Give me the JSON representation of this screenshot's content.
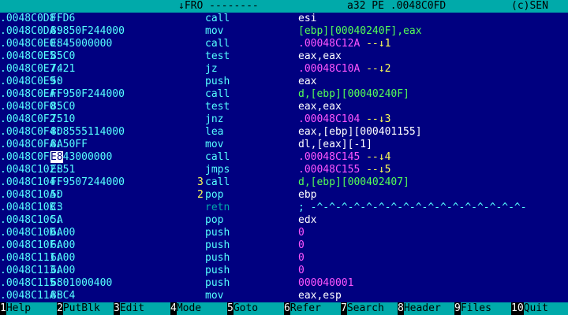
{
  "statusbar": {
    "left": "↓FRO --------",
    "middle": "a32 PE .0048C0FD",
    "right": "(c)SEN"
  },
  "rows": [
    {
      "addr": ".0048C0D8:",
      "hex": "FFD6",
      "mnem": "call",
      "op": "esi",
      "op_color": "white"
    },
    {
      "addr": ".0048C0DA:",
      "hex": "89850F244000",
      "mnem": "mov",
      "op": "[ebp][00040240F],eax",
      "op_color": "green"
    },
    {
      "addr": ".0048C0E0:",
      "hex": "E845000000",
      "mnem": "call",
      "op": ".00048C12A",
      "op_color": "magenta",
      "arrow": " --↓1"
    },
    {
      "addr": ".0048C0E5:",
      "hex": "85C0",
      "mnem": "test",
      "op": "eax,eax",
      "op_color": "white"
    },
    {
      "addr": ".0048C0E7:",
      "hex": "7421",
      "mnem": "jz",
      "op": ".00048C10A",
      "op_color": "magenta",
      "arrow": " --↓2"
    },
    {
      "addr": ".0048C0E9:",
      "hex": "50",
      "mnem": "push",
      "op": "eax",
      "op_color": "white"
    },
    {
      "addr": ".0048C0EA:",
      "hex": "FF950F244000",
      "mnem": "call",
      "op": "d,[ebp][00040240F]",
      "op_color": "green"
    },
    {
      "addr": ".0048C0F0:",
      "hex": "85C0",
      "mnem": "test",
      "op": "eax,eax",
      "op_color": "white"
    },
    {
      "addr": ".0048C0F2:",
      "hex": "7510",
      "mnem": "jnz",
      "op": ".00048C104",
      "op_color": "magenta",
      "arrow": " --↓3"
    },
    {
      "addr": ".0048C0F4:",
      "hex": "8D8555114000",
      "mnem": "lea",
      "op": "eax,[ebp][000401155]",
      "op_color": "white"
    },
    {
      "addr": ".0048C0FA:",
      "hex": "8A50FF",
      "mnem": "mov",
      "op": "dl,[eax][-1]",
      "op_color": "white"
    },
    {
      "addr": ".0048C0FD:",
      "hex_cursor": "E8",
      "hex": "43000000",
      "mnem": "call",
      "op": ".00048C145",
      "op_color": "magenta",
      "arrow": " --↓4"
    },
    {
      "addr": ".0048C102:",
      "hex": "EB51",
      "mnem": "jmps",
      "op": ".00048C155",
      "op_color": "magenta",
      "arrow": " --↓5"
    },
    {
      "addr": ".0048C104:",
      "hex": "FF9507244000",
      "marker": "3",
      "mnem": "call",
      "op": "d,[ebp][000402407]",
      "op_color": "green"
    },
    {
      "addr": ".0048C10A:",
      "hex": "5D",
      "marker": "2",
      "mnem": "pop",
      "op": "ebp",
      "op_color": "white"
    },
    {
      "addr": ".0048C10B:",
      "hex": "C3",
      "mnem": "retn",
      "op": "; -^-^-^-^-^-^-^-^-^-^-^-^-^-^-^-^-^-",
      "op_color": "retn"
    },
    {
      "addr": ".0048C10C:",
      "hex": "5A",
      "mnem": "pop",
      "op": "edx",
      "op_color": "white"
    },
    {
      "addr": ".0048C10D:",
      "hex": "6A00",
      "mnem": "push",
      "op": "0",
      "op_color": "magenta"
    },
    {
      "addr": ".0048C10F:",
      "hex": "6A00",
      "mnem": "push",
      "op": "0",
      "op_color": "magenta"
    },
    {
      "addr": ".0048C111:",
      "hex": "6A00",
      "mnem": "push",
      "op": "0",
      "op_color": "magenta"
    },
    {
      "addr": ".0048C113:",
      "hex": "6A00",
      "mnem": "push",
      "op": "0",
      "op_color": "magenta"
    },
    {
      "addr": ".0048C115:",
      "hex": "6801000400",
      "mnem": "push",
      "op": "000040001",
      "op_color": "magenta"
    },
    {
      "addr": ".0048C11A:",
      "hex": "8BC4",
      "mnem": "mov",
      "op": "eax,esp",
      "op_color": "white"
    }
  ],
  "fkeys": [
    {
      "num": "1",
      "label": "Help"
    },
    {
      "num": "2",
      "label": "PutBlk"
    },
    {
      "num": "3",
      "label": "Edit"
    },
    {
      "num": "4",
      "label": "Mode"
    },
    {
      "num": "5",
      "label": "Goto"
    },
    {
      "num": "6",
      "label": "Refer"
    },
    {
      "num": "7",
      "label": "Search"
    },
    {
      "num": "8",
      "label": "Header"
    },
    {
      "num": "9",
      "label": "Files"
    },
    {
      "num": "10",
      "label": "Quit"
    }
  ]
}
